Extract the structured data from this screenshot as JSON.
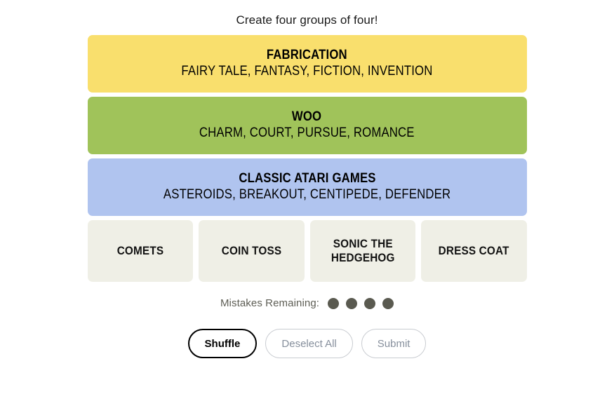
{
  "header": {
    "instruction": "Create four groups of four!"
  },
  "board": {
    "solved_groups": [
      {
        "category": "FABRICATION",
        "members": "FAIRY TALE, FANTASY, FICTION, INVENTION",
        "color": "#f9df6d"
      },
      {
        "category": "WOO",
        "members": "CHARM, COURT, PURSUE, ROMANCE",
        "color": "#a0c35a"
      },
      {
        "category": "CLASSIC ATARI GAMES",
        "members": "ASTEROIDS, BREAKOUT, CENTIPEDE, DEFENDER",
        "color": "#b0c4ef"
      }
    ],
    "tiles": [
      {
        "label": "COMETS"
      },
      {
        "label": "COIN TOSS"
      },
      {
        "label": "SONIC THE HEDGEHOG"
      },
      {
        "label": "DRESS COAT"
      }
    ],
    "tile_color": "#efefe6"
  },
  "mistakes": {
    "label": "Mistakes Remaining:",
    "remaining": 4,
    "dot_color": "#5a5a50"
  },
  "controls": {
    "shuffle": {
      "label": "Shuffle",
      "state": "enabled"
    },
    "deselect_all": {
      "label": "Deselect All",
      "state": "disabled"
    },
    "submit": {
      "label": "Submit",
      "state": "disabled"
    }
  }
}
